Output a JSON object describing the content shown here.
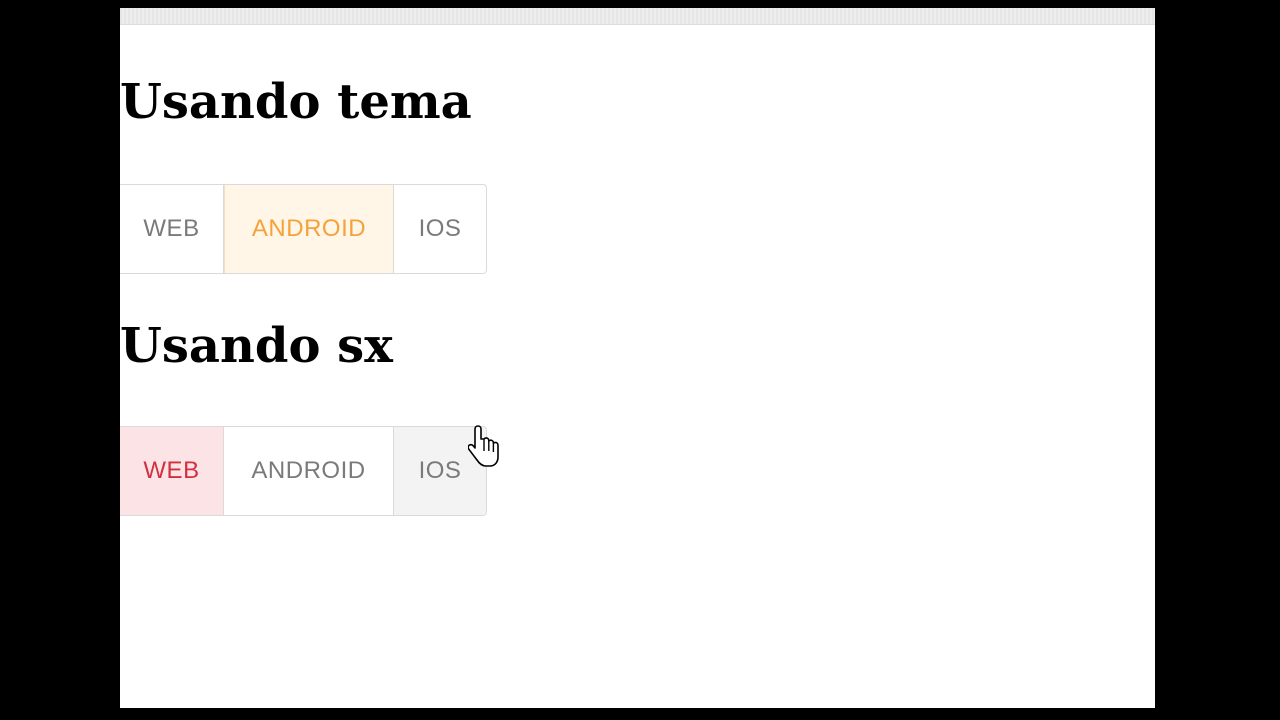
{
  "section_theme": {
    "title": "Usando tema",
    "buttons": [
      {
        "label": "WEB",
        "selected": false
      },
      {
        "label": "ANDROID",
        "selected": true
      },
      {
        "label": "IOS",
        "selected": false
      }
    ]
  },
  "section_sx": {
    "title": "Usando sx",
    "buttons": [
      {
        "label": "WEB",
        "selected": true
      },
      {
        "label": "ANDROID",
        "selected": false
      },
      {
        "label": "IOS",
        "selected": false,
        "hovered": true
      }
    ]
  },
  "colors": {
    "page_background": "#000000",
    "viewport_background": "#ffffff",
    "theme_selected_text": "#f5a23a",
    "theme_selected_bg": "#fff6e8",
    "sx_selected_text": "#d3303f",
    "sx_selected_bg": "#fce4e6",
    "unselected_text": "#7a7a7a",
    "hover_bg": "#f3f3f3"
  },
  "cursor": {
    "icon": "hand-pointer-icon"
  }
}
